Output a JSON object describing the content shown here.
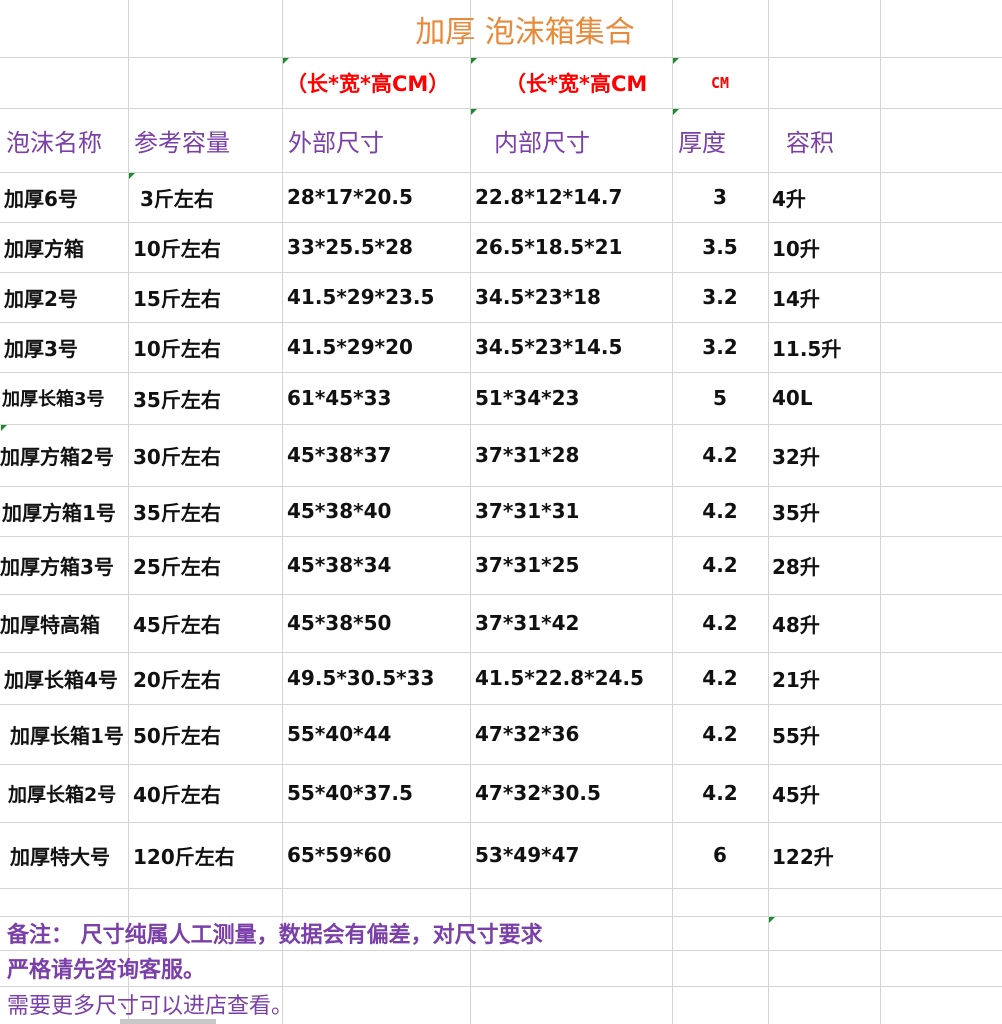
{
  "title": "加厚 泡沫箱集合",
  "units": {
    "outer": "（长*宽*高CM）",
    "inner": "（长*宽*高CM",
    "thickness": "CM"
  },
  "headers": [
    "泡沫名称",
    "参考容量",
    "外部尺寸",
    "内部尺寸",
    "厚度",
    "容积"
  ],
  "rows": [
    [
      "加厚6号",
      "3斤左右",
      "28*17*20.5",
      "22.8*12*14.7",
      "3",
      "4升"
    ],
    [
      "加厚方箱",
      "10斤左右",
      "33*25.5*28",
      "26.5*18.5*21",
      "3.5",
      "10升"
    ],
    [
      "加厚2号",
      "15斤左右",
      "41.5*29*23.5",
      "34.5*23*18",
      "3.2",
      "14升"
    ],
    [
      "加厚3号",
      "10斤左右",
      "41.5*29*20",
      "34.5*23*14.5",
      "3.2",
      "11.5升"
    ],
    [
      "加厚长箱3号",
      "35斤左右",
      "61*45*33",
      "51*34*23",
      "5",
      "40L"
    ],
    [
      "加厚方箱2号",
      "30斤左右",
      "45*38*37",
      "37*31*28",
      "4.2",
      "32升"
    ],
    [
      "加厚方箱1号",
      "35斤左右",
      "45*38*40",
      "37*31*31",
      "4.2",
      "35升"
    ],
    [
      "加厚方箱3号",
      "25斤左右",
      "45*38*34",
      "37*31*25",
      "4.2",
      "28升"
    ],
    [
      "加厚特高箱",
      "45斤左右",
      "45*38*50",
      "37*31*42",
      "4.2",
      "48升"
    ],
    [
      "加厚长箱4号",
      "20斤左右",
      "49.5*30.5*33",
      "41.5*22.8*24.5",
      "4.2",
      "21升"
    ],
    [
      "加厚长箱1号",
      "50斤左右",
      "55*40*44",
      "47*32*36",
      "4.2",
      "55升"
    ],
    [
      "加厚长箱2号",
      "40斤左右",
      "55*40*37.5",
      "47*32*30.5",
      "4.2",
      "45升"
    ],
    [
      "加厚特大号",
      "120斤左右",
      "65*59*60",
      "53*49*47",
      "6",
      "122升"
    ]
  ],
  "notes": [
    "备注：  尺寸纯属人工测量，数据会有偏差，对尺寸要求",
    "严格请先咨询客服。",
    "需要更多尺寸可以进店查看。"
  ]
}
